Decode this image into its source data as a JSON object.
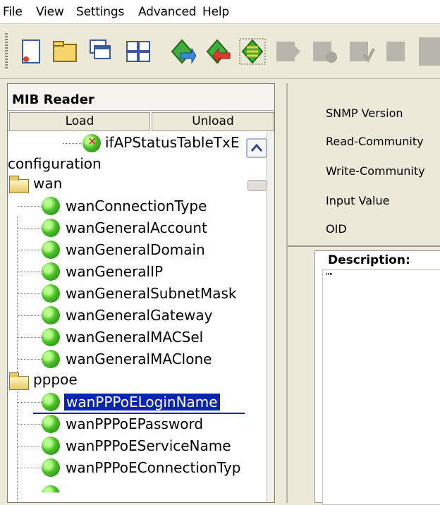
{
  "menu": [
    "File",
    "View",
    "Settings",
    "Advanced",
    "Help"
  ],
  "toolbar_icons": [
    "new-icon",
    "open-icon",
    "cascade-icon",
    "tile-icon",
    "get-icon",
    "set-icon",
    "walk-icon",
    "disabled-icon-1",
    "disabled-icon-2",
    "disabled-icon-3",
    "disabled-icon-4"
  ],
  "left_panel": {
    "title": "MIB Reader",
    "load_label": "Load",
    "unload_label": "Unload"
  },
  "tree": {
    "top_partial": "ifAPStatusTableTxE",
    "section": "configuration",
    "wan_folder": "wan",
    "wan_items": [
      "wanConnectionType",
      "wanGeneralAccount",
      "wanGeneralDomain",
      "wanGeneralIP",
      "wanGeneralSubnetMask",
      "wanGeneralGateway",
      "wanGeneralMACSel",
      "wanGeneralMAClone"
    ],
    "pppoe_folder": "pppoe",
    "pppoe_items": [
      "wanPPPoELoginName",
      "wanPPPoEPassword",
      "wanPPPoEServiceName",
      "wanPPPoEConnectionTyp"
    ],
    "selected": "wanPPPoELoginName"
  },
  "right_panel": {
    "snmp_version": "SNMP Version",
    "read_community": "Read-Community",
    "write_community": "Write-Community",
    "input_value": "Input Value",
    "oid": "OID",
    "description_title": "Description:",
    "description_text": "\"\""
  }
}
